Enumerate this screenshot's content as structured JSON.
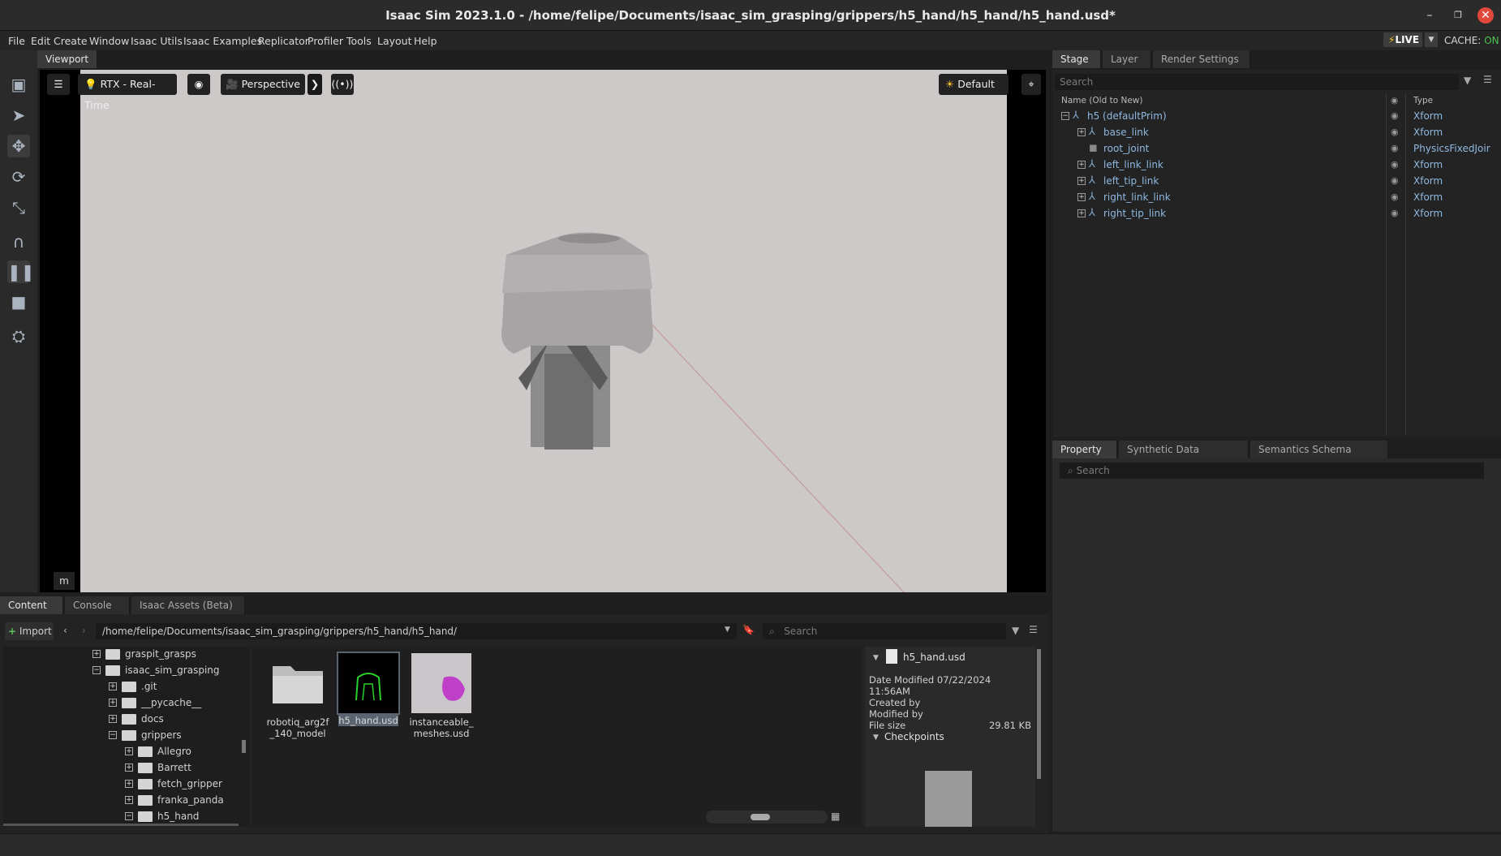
{
  "window": {
    "title": "Isaac Sim 2023.1.0 - /home/felipe/Documents/isaac_sim_grasping/grippers/h5_hand/h5_hand/h5_hand.usd*"
  },
  "menu": [
    "File",
    "Edit",
    "Create",
    "Window",
    "Isaac Utils",
    "Isaac Examples",
    "Replicator",
    "Profiler",
    "Tools",
    "Layout",
    "Help"
  ],
  "live": {
    "label": "LIVE",
    "cache_label": "CACHE:",
    "cache_state": "ON"
  },
  "viewport": {
    "tab": "Viewport",
    "renderer": "RTX - Real-Time",
    "camera": "Perspective",
    "lighting": "Default",
    "units_btn": "m"
  },
  "stage": {
    "tabs": [
      "Stage",
      "Layer",
      "Render Settings"
    ],
    "search_placeholder": "Search",
    "col_name": "Name (Old to New)",
    "col_type": "Type",
    "rows": [
      {
        "name": "h5 (defaultPrim)",
        "type": "Xform"
      },
      {
        "name": "base_link",
        "type": "Xform"
      },
      {
        "name": "root_joint",
        "type": "PhysicsFixedJoir"
      },
      {
        "name": "left_link_link",
        "type": "Xform"
      },
      {
        "name": "left_tip_link",
        "type": "Xform"
      },
      {
        "name": "right_link_link",
        "type": "Xform"
      },
      {
        "name": "right_tip_link",
        "type": "Xform"
      }
    ]
  },
  "property": {
    "tabs": [
      "Property",
      "Synthetic Data Recorder",
      "Semantics Schema Editor"
    ],
    "search_placeholder": "Search"
  },
  "content": {
    "tabs": [
      "Content",
      "Console",
      "Isaac Assets (Beta)"
    ],
    "import_label": "Import",
    "path": "/home/felipe/Documents/isaac_sim_grasping/grippers/h5_hand/h5_hand/",
    "search_placeholder": "Search",
    "tree": [
      "graspit_grasps",
      "isaac_sim_grasping",
      ".git",
      "__pycache__",
      "docs",
      "grippers",
      "Allegro",
      "Barrett",
      "fetch_gripper",
      "franka_panda",
      "h5_hand"
    ],
    "files": [
      {
        "line1": "robotiq_arg2f",
        "line2": "_140_model"
      },
      {
        "line1": "h5_hand.usd",
        "line2": ""
      },
      {
        "line1": "instanceable_",
        "line2": "meshes.usd"
      }
    ],
    "details": {
      "filename": "h5_hand.usd",
      "date_label": "Date Modified",
      "date_value": "07/22/2024 11:56AM",
      "created_by": "Created by",
      "modified_by": "Modified by",
      "size_label": "File size",
      "size_value": "29.81 KB",
      "checkpoints": "Checkpoints"
    }
  }
}
